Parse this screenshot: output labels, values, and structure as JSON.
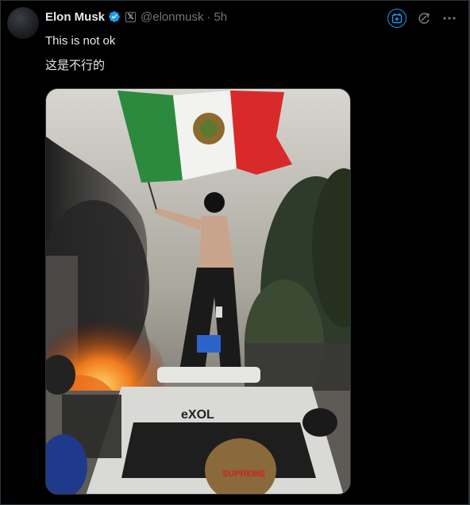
{
  "post": {
    "author_name": "Elon Musk",
    "affiliate_badge": "𝕏",
    "handle": "@elonmusk",
    "separator": "·",
    "timestamp": "5h",
    "text_lines": [
      "This is not ok",
      "这是不行的"
    ]
  },
  "media": {
    "graffiti_text": "eXOL",
    "cap_text": "SUPREME"
  },
  "icons": {
    "verified": "verified-badge-icon",
    "grok": "grok-icon",
    "refresh": "refresh-icon",
    "more": "more-icon"
  },
  "colors": {
    "background": "#000000",
    "text": "#e7e9ea",
    "muted": "#71767b",
    "accent": "#1d9bf0"
  }
}
